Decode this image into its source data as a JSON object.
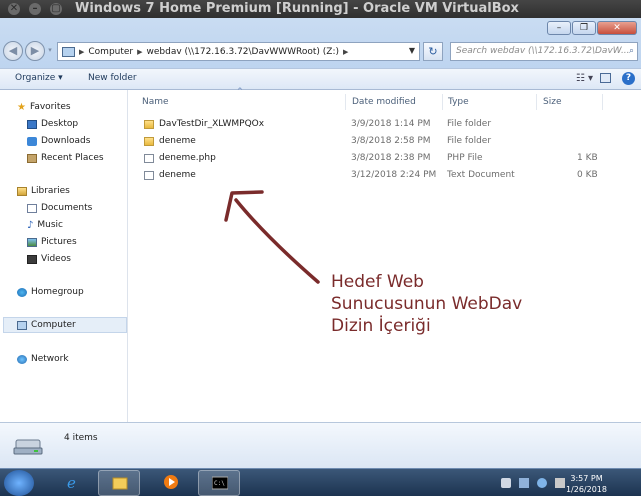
{
  "host_window": {
    "title": "Windows 7 Home Premium [Running] - Oracle VM VirtualBox",
    "controls": [
      "close",
      "minimize",
      "maximize"
    ]
  },
  "explorer": {
    "breadcrumb": [
      "Computer",
      "webdav (\\\\172.16.3.72\\DavWWWRoot) (Z:)"
    ],
    "search_placeholder": "Search webdav (\\\\172.16.3.72\\DavW...",
    "toolbar": {
      "organize": "Organize ▾",
      "new_folder": "New folder"
    },
    "nav": {
      "favorites": "Favorites",
      "desktop": "Desktop",
      "downloads": "Downloads",
      "recent": "Recent Places",
      "libraries": "Libraries",
      "documents": "Documents",
      "music": "Music",
      "pictures": "Pictures",
      "videos": "Videos",
      "homegroup": "Homegroup",
      "computer": "Computer",
      "network": "Network"
    },
    "columns": {
      "name": "Name",
      "date": "Date modified",
      "type": "Type",
      "size": "Size"
    },
    "files": [
      {
        "name": "DavTestDir_XLWMPQOx",
        "date": "3/9/2018 1:14 PM",
        "type": "File folder",
        "size": "",
        "icon": "folder"
      },
      {
        "name": "deneme",
        "date": "3/8/2018 2:58 PM",
        "type": "File folder",
        "size": "",
        "icon": "folder"
      },
      {
        "name": "deneme.php",
        "date": "3/8/2018 2:38 PM",
        "type": "PHP File",
        "size": "1 KB",
        "icon": "file"
      },
      {
        "name": "deneme",
        "date": "3/12/2018 2:24 PM",
        "type": "Text Document",
        "size": "0 KB",
        "icon": "file"
      }
    ],
    "status": {
      "item_count": "4 items"
    }
  },
  "annotation": {
    "line1": "Hedef Web",
    "line2": "Sunucusunun WebDav",
    "line3": "Dizin İçeriği",
    "color": "#7a2b2b"
  },
  "taskbar": {
    "time": "3:57 PM",
    "date": "1/26/2018"
  }
}
